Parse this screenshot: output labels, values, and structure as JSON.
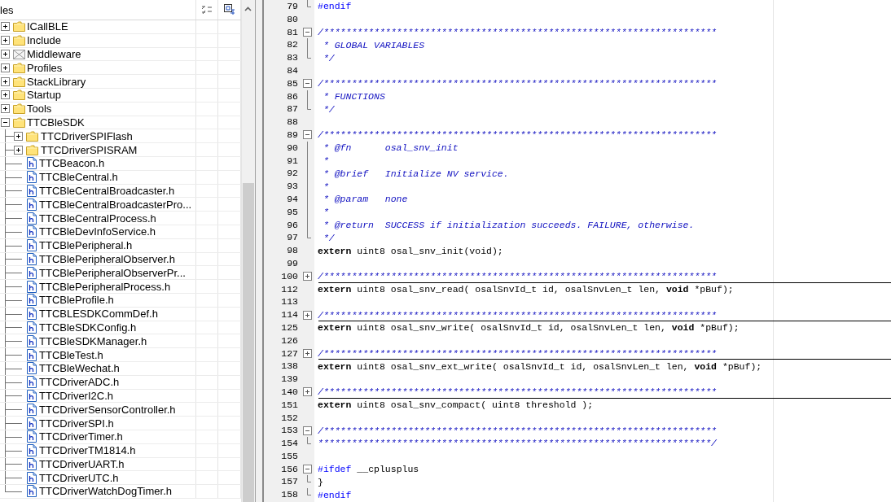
{
  "project_pane": {
    "header": "les",
    "items": [
      {
        "label": "ICallBLE",
        "kind": "folder",
        "expanded": false
      },
      {
        "label": "Include",
        "kind": "folder",
        "expanded": false
      },
      {
        "label": "Middleware",
        "kind": "group",
        "expanded": false
      },
      {
        "label": "Profiles",
        "kind": "folder",
        "expanded": false
      },
      {
        "label": "StackLibrary",
        "kind": "folder",
        "expanded": false
      },
      {
        "label": "Startup",
        "kind": "folder",
        "expanded": false
      },
      {
        "label": "Tools",
        "kind": "folder",
        "expanded": false
      },
      {
        "label": "TTCBleSDK",
        "kind": "folder",
        "expanded": true,
        "children": [
          {
            "label": "TTCDriverSPIFlash",
            "kind": "folder",
            "expanded": false
          },
          {
            "label": "TTCDriverSPISRAM",
            "kind": "folder",
            "expanded": false
          },
          {
            "label": "TTCBeacon.h",
            "kind": "file"
          },
          {
            "label": "TTCBleCentral.h",
            "kind": "file"
          },
          {
            "label": "TTCBleCentralBroadcaster.h",
            "kind": "file"
          },
          {
            "label": "TTCBleCentralBroadcasterPro...",
            "kind": "file"
          },
          {
            "label": "TTCBleCentralProcess.h",
            "kind": "file"
          },
          {
            "label": "TTCBleDevInfoService.h",
            "kind": "file"
          },
          {
            "label": "TTCBlePeripheral.h",
            "kind": "file"
          },
          {
            "label": "TTCBlePeripheralObserver.h",
            "kind": "file"
          },
          {
            "label": "TTCBlePeripheralObserverPr...",
            "kind": "file"
          },
          {
            "label": "TTCBlePeripheralProcess.h",
            "kind": "file"
          },
          {
            "label": "TTCBleProfile.h",
            "kind": "file"
          },
          {
            "label": "TTCBLESDKCommDef.h",
            "kind": "file"
          },
          {
            "label": "TTCBleSDKConfig.h",
            "kind": "file"
          },
          {
            "label": "TTCBleSDKManager.h",
            "kind": "file"
          },
          {
            "label": "TTCBleTest.h",
            "kind": "file"
          },
          {
            "label": "TTCBleWechat.h",
            "kind": "file"
          },
          {
            "label": "TTCDriverADC.h",
            "kind": "file"
          },
          {
            "label": "TTCDriverI2C.h",
            "kind": "file"
          },
          {
            "label": "TTCDriverSensorController.h",
            "kind": "file"
          },
          {
            "label": "TTCDriverSPI.h",
            "kind": "file"
          },
          {
            "label": "TTCDriverTimer.h",
            "kind": "file"
          },
          {
            "label": "TTCDriverTM1814.h",
            "kind": "file"
          },
          {
            "label": "TTCDriverUART.h",
            "kind": "file"
          },
          {
            "label": "TTCDriverUTC.h",
            "kind": "file"
          },
          {
            "label": "TTCDriverWatchDogTimer.h",
            "kind": "file"
          }
        ]
      }
    ]
  },
  "editor": {
    "lines": [
      {
        "number": "79",
        "kind": "fold-end",
        "segments": [
          {
            "kind": "preproc",
            "text": "#endif"
          }
        ]
      },
      {
        "number": "80"
      },
      {
        "number": "81",
        "kind": "fold-open",
        "segments": [
          {
            "kind": "comment",
            "text": "/**********************************************************************"
          }
        ]
      },
      {
        "number": "82",
        "kind": "fold-body",
        "segments": [
          {
            "kind": "comment",
            "text": " * GLOBAL VARIABLES"
          }
        ]
      },
      {
        "number": "83",
        "kind": "fold-end",
        "segments": [
          {
            "kind": "comment",
            "text": " */"
          }
        ]
      },
      {
        "number": "84"
      },
      {
        "number": "85",
        "kind": "fold-open",
        "segments": [
          {
            "kind": "comment",
            "text": "/**********************************************************************"
          }
        ]
      },
      {
        "number": "86",
        "kind": "fold-body",
        "segments": [
          {
            "kind": "comment",
            "text": " * FUNCTIONS"
          }
        ]
      },
      {
        "number": "87",
        "kind": "fold-end",
        "segments": [
          {
            "kind": "comment",
            "text": " */"
          }
        ]
      },
      {
        "number": "88"
      },
      {
        "number": "89",
        "kind": "fold-open",
        "segments": [
          {
            "kind": "comment",
            "text": "/**********************************************************************"
          }
        ]
      },
      {
        "number": "90",
        "kind": "fold-body",
        "segments": [
          {
            "kind": "comment",
            "text": " * @fn      osal_snv_init"
          }
        ]
      },
      {
        "number": "91",
        "kind": "fold-body",
        "segments": [
          {
            "kind": "comment",
            "text": " *"
          }
        ]
      },
      {
        "number": "92",
        "kind": "fold-body",
        "segments": [
          {
            "kind": "comment",
            "text": " * @brief   Initialize NV service."
          }
        ]
      },
      {
        "number": "93",
        "kind": "fold-body",
        "segments": [
          {
            "kind": "comment",
            "text": " *"
          }
        ]
      },
      {
        "number": "94",
        "kind": "fold-body",
        "segments": [
          {
            "kind": "comment",
            "text": " * @param   none"
          }
        ]
      },
      {
        "number": "95",
        "kind": "fold-body",
        "segments": [
          {
            "kind": "comment",
            "text": " *"
          }
        ]
      },
      {
        "number": "96",
        "kind": "fold-body",
        "segments": [
          {
            "kind": "comment",
            "text": " * @return  SUCCESS if initialization succeeds. FAILURE, otherwise."
          }
        ]
      },
      {
        "number": "97",
        "kind": "fold-end",
        "segments": [
          {
            "kind": "comment",
            "text": " */"
          }
        ]
      },
      {
        "number": "98",
        "segments": [
          {
            "kind": "keyword",
            "text": "extern"
          },
          {
            "kind": "code",
            "text": " uint8 osal_snv_init(void);"
          }
        ]
      },
      {
        "number": "99"
      },
      {
        "number": "100",
        "kind": "fold-closed",
        "segments": [
          {
            "kind": "comment",
            "text": "/**********************************************************************"
          }
        ]
      },
      {
        "number": "112",
        "segments": [
          {
            "kind": "keyword",
            "text": "extern"
          },
          {
            "kind": "code",
            "text": " uint8 osal_snv_read( osalSnvId_t id, osalSnvLen_t len, "
          },
          {
            "kind": "keyword",
            "text": "void"
          },
          {
            "kind": "code",
            "text": " *pBuf);"
          }
        ]
      },
      {
        "number": "113"
      },
      {
        "number": "114",
        "kind": "fold-closed",
        "segments": [
          {
            "kind": "comment",
            "text": "/**********************************************************************"
          }
        ]
      },
      {
        "number": "125",
        "segments": [
          {
            "kind": "keyword",
            "text": "extern"
          },
          {
            "kind": "code",
            "text": " uint8 osal_snv_write( osalSnvId_t id, osalSnvLen_t len, "
          },
          {
            "kind": "keyword",
            "text": "void"
          },
          {
            "kind": "code",
            "text": " *pBuf);"
          }
        ]
      },
      {
        "number": "126"
      },
      {
        "number": "127",
        "kind": "fold-closed",
        "segments": [
          {
            "kind": "comment",
            "text": "/**********************************************************************"
          }
        ]
      },
      {
        "number": "138",
        "segments": [
          {
            "kind": "keyword",
            "text": "extern"
          },
          {
            "kind": "code",
            "text": " uint8 osal_snv_ext_write( osalSnvId_t id, osalSnvLen_t len, "
          },
          {
            "kind": "keyword",
            "text": "void"
          },
          {
            "kind": "code",
            "text": " *pBuf);"
          }
        ]
      },
      {
        "number": "139"
      },
      {
        "number": "140",
        "kind": "fold-closed",
        "segments": [
          {
            "kind": "comment",
            "text": "/**********************************************************************"
          }
        ]
      },
      {
        "number": "151",
        "segments": [
          {
            "kind": "keyword",
            "text": "extern"
          },
          {
            "kind": "code",
            "text": " uint8 osal_snv_compact( uint8 threshold );"
          }
        ]
      },
      {
        "number": "152"
      },
      {
        "number": "153",
        "kind": "fold-open",
        "segments": [
          {
            "kind": "comment",
            "text": "/**********************************************************************"
          }
        ]
      },
      {
        "number": "154",
        "kind": "fold-end",
        "segments": [
          {
            "kind": "comment",
            "text": "**********************************************************************/"
          }
        ]
      },
      {
        "number": "155"
      },
      {
        "number": "156",
        "kind": "fold-open",
        "segments": [
          {
            "kind": "preproc",
            "text": "#ifdef"
          },
          {
            "kind": "code",
            "text": " __cplusplus"
          }
        ]
      },
      {
        "number": "157",
        "kind": "fold-end",
        "segments": [
          {
            "kind": "code",
            "text": "}"
          }
        ]
      },
      {
        "number": "158",
        "kind": "fold-end",
        "segments": [
          {
            "kind": "preproc",
            "text": "#endif"
          }
        ]
      }
    ]
  }
}
